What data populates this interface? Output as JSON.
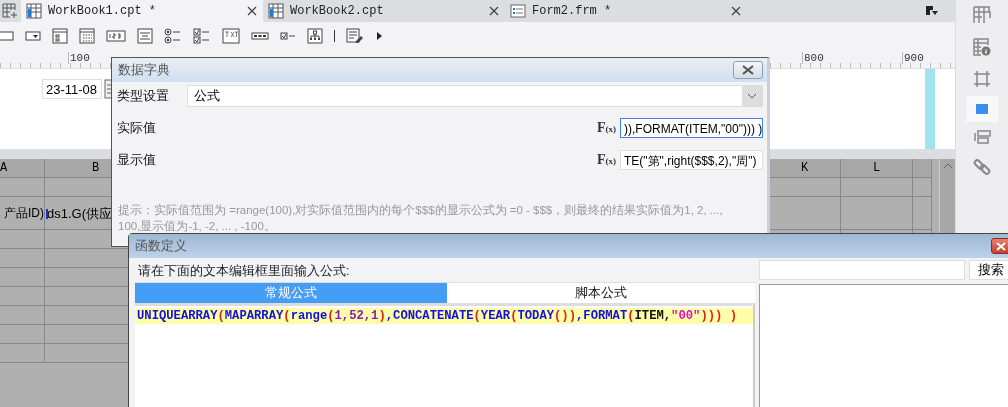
{
  "tabs": [
    {
      "label": "WorkBook1.cpt *",
      "kind": "workbook",
      "selected": true
    },
    {
      "label": "WorkBook2.cpt",
      "kind": "workbook",
      "selected": false
    },
    {
      "label": "Form2.frm *",
      "kind": "form",
      "selected": false
    }
  ],
  "ruler": {
    "labels": [
      "100",
      "800",
      "900"
    ]
  },
  "canvas": {
    "date_field": "23-11-08"
  },
  "sheet": {
    "columns": [
      "A",
      "B",
      "K",
      "L"
    ],
    "cells": [
      "产品ID)",
      "ds1.G(供应"
    ]
  },
  "dict_dialog": {
    "title": "数据字典",
    "type_label": "类型设置",
    "type_value": "公式",
    "actual_label": "实际值",
    "actual_mark": "F$_{(x)}$",
    "actual_value": ")),FORMAT(ITEM,\"00\"))) )",
    "display_label": "显示值",
    "display_mark": "F$_{(x)}$",
    "display_value": "TE(\"第\",right($$$,2),\"周\")",
    "hint": "提示：实际值范围为 =range(100),对实际值范围内的每个$$$的显示公式为 =0 - $$$，则最终的结果实际值为1, 2, ..., 100,显示值为-1, -2, ... , -100。"
  },
  "func_dialog": {
    "title": "函数定义",
    "prompt": "请在下面的文本编辑框里面输入公式:",
    "tabs": [
      {
        "label": "常规公式",
        "selected": true
      },
      {
        "label": "脚本公式",
        "selected": false
      }
    ],
    "tokens": [
      {
        "text": "UNIQUEARRAY",
        "kind": "function"
      },
      {
        "text": "(",
        "kind": "paren"
      },
      {
        "text": "MAPARRAY",
        "kind": "function"
      },
      {
        "text": "(",
        "kind": "paren"
      },
      {
        "text": "range",
        "kind": "function"
      },
      {
        "text": "(",
        "kind": "paren"
      },
      {
        "text": "1,52,1",
        "kind": "number"
      },
      {
        "text": ")",
        "kind": "paren"
      },
      {
        "text": ",",
        "kind": "function"
      },
      {
        "text": "CONCATENATE",
        "kind": "function"
      },
      {
        "text": "(",
        "kind": "paren"
      },
      {
        "text": "YEAR",
        "kind": "function"
      },
      {
        "text": "(",
        "kind": "paren"
      },
      {
        "text": "TODAY",
        "kind": "function"
      },
      {
        "text": "())",
        "kind": "paren"
      },
      {
        "text": ",",
        "kind": "function"
      },
      {
        "text": "FORMAT",
        "kind": "function"
      },
      {
        "text": "(",
        "kind": "paren"
      },
      {
        "text": "ITEM,",
        "kind": "name"
      },
      {
        "text": "\"00\"",
        "kind": "string"
      },
      {
        "text": "))) )",
        "kind": "paren"
      }
    ],
    "search_button": "搜索"
  }
}
